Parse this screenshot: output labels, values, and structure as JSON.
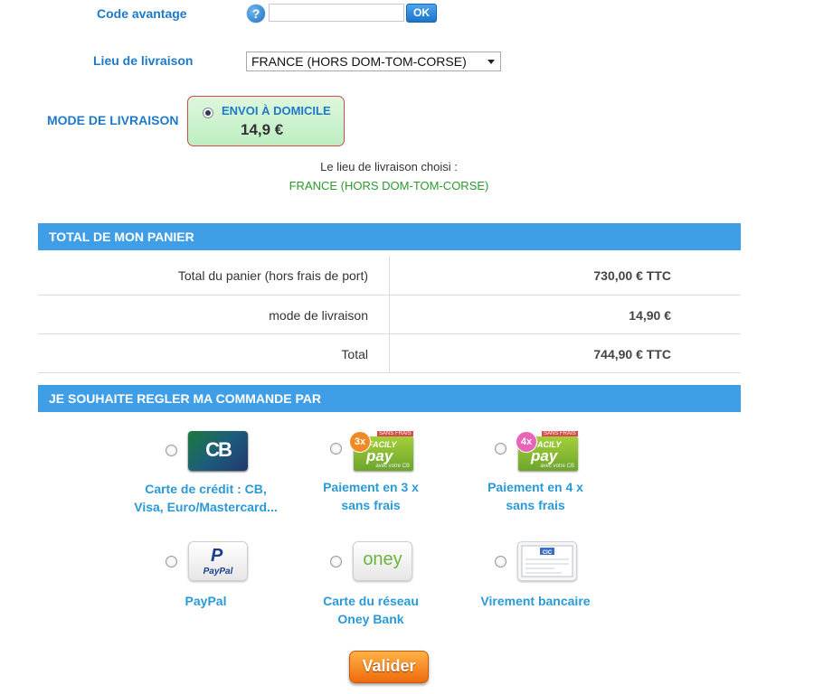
{
  "promo": {
    "label": "Code avantage",
    "help": "?",
    "input_value": "",
    "ok_label": "OK"
  },
  "delivery_place": {
    "label": "Lieu de livraison",
    "selected": "FRANCE (HORS DOM-TOM-CORSE)"
  },
  "delivery_mode": {
    "label": "MODE DE LIVRAISON",
    "option_label": "ENVOI À DOMICILE",
    "option_price": "14,9 €",
    "chosen_caption": "Le lieu de livraison choisi :",
    "chosen_value": "FRANCE (HORS DOM-TOM-CORSE)"
  },
  "cart": {
    "title": "TOTAL DE MON PANIER",
    "rows": [
      {
        "label": "Total du panier (hors frais de port)",
        "value": "730,00 € TTC"
      },
      {
        "label": "mode de livraison",
        "value": "14,90 €"
      },
      {
        "label": "Total",
        "value": "744,90 € TTC"
      }
    ]
  },
  "payment": {
    "title": "JE SOUHAITE REGLER MA COMMANDE PAR",
    "logos": {
      "cb": "CB",
      "facily_small": "FACILY",
      "facily_big": "pay",
      "facily_sub": "avec votre CB",
      "sans_frais": "SANS FRAIS",
      "badge3": "3x",
      "badge4": "4x",
      "paypal_p": "P",
      "paypal_word": "PayPal",
      "oney": "oney",
      "cic": "CIC"
    },
    "options": [
      {
        "line1": "Carte de crédit : CB,",
        "line2": "Visa, Euro/Mastercard..."
      },
      {
        "line1": "Paiement en 3 x",
        "line2": "sans frais"
      },
      {
        "line1": "Paiement en 4 x",
        "line2": "sans frais"
      },
      {
        "line1": "PayPal",
        "line2": ""
      },
      {
        "line1": "Carte du réseau",
        "line2": "Oney Bank"
      },
      {
        "line1": "Virement bancaire",
        "line2": ""
      }
    ]
  },
  "submit_label": "Valider"
}
